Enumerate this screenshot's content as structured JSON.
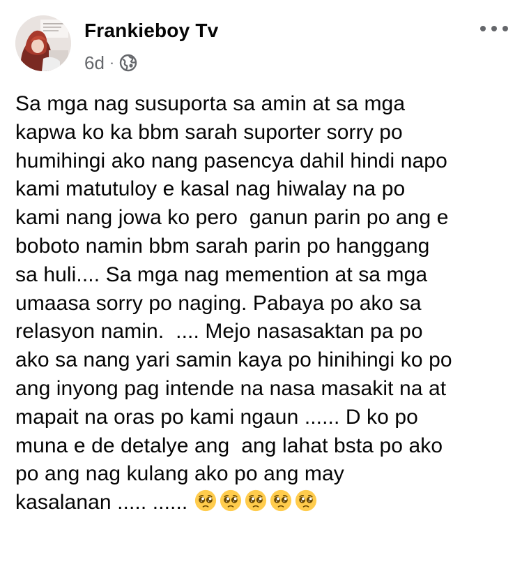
{
  "post": {
    "author": "Frankieboy Tv",
    "time": "6d",
    "separator": "·",
    "privacy_icon": "globe-icon",
    "more_icon": "more-options-icon",
    "body_lines": [
      "Sa mga nag susuporta sa amin at sa mga",
      "kapwa ko ka bbm sarah suporter sorry po",
      "humihingi ako nang pasencya dahil hindi napo",
      "kami matutuloy e kasal nag hiwalay na po",
      "kami nang jowa ko pero  ganun parin po ang e",
      "boboto namin bbm sarah parin po hanggang",
      "sa huli.... Sa mga nag memention at sa mga",
      "umaasa sorry po naging. Pabaya po ako sa",
      "relasyon namin.  .... Mejo nasasaktan pa po",
      "ako sa nang yari samin kaya po hinihingi ko po",
      "ang inyong pag intende na nasa masakit na at",
      "mapait na oras po kami ngaun ...... D ko po",
      "muna e de detalye ang  ang lahat bsta po ako",
      "po ang nag kulang ako po ang may",
      "kasalanan ..... ......"
    ],
    "emojis": [
      "pleading-face",
      "pleading-face",
      "pleading-face",
      "pleading-face",
      "pleading-face"
    ],
    "colors": {
      "text": "#050505",
      "secondary": "#65676b",
      "emoji_face": "#FFCC4D"
    }
  }
}
